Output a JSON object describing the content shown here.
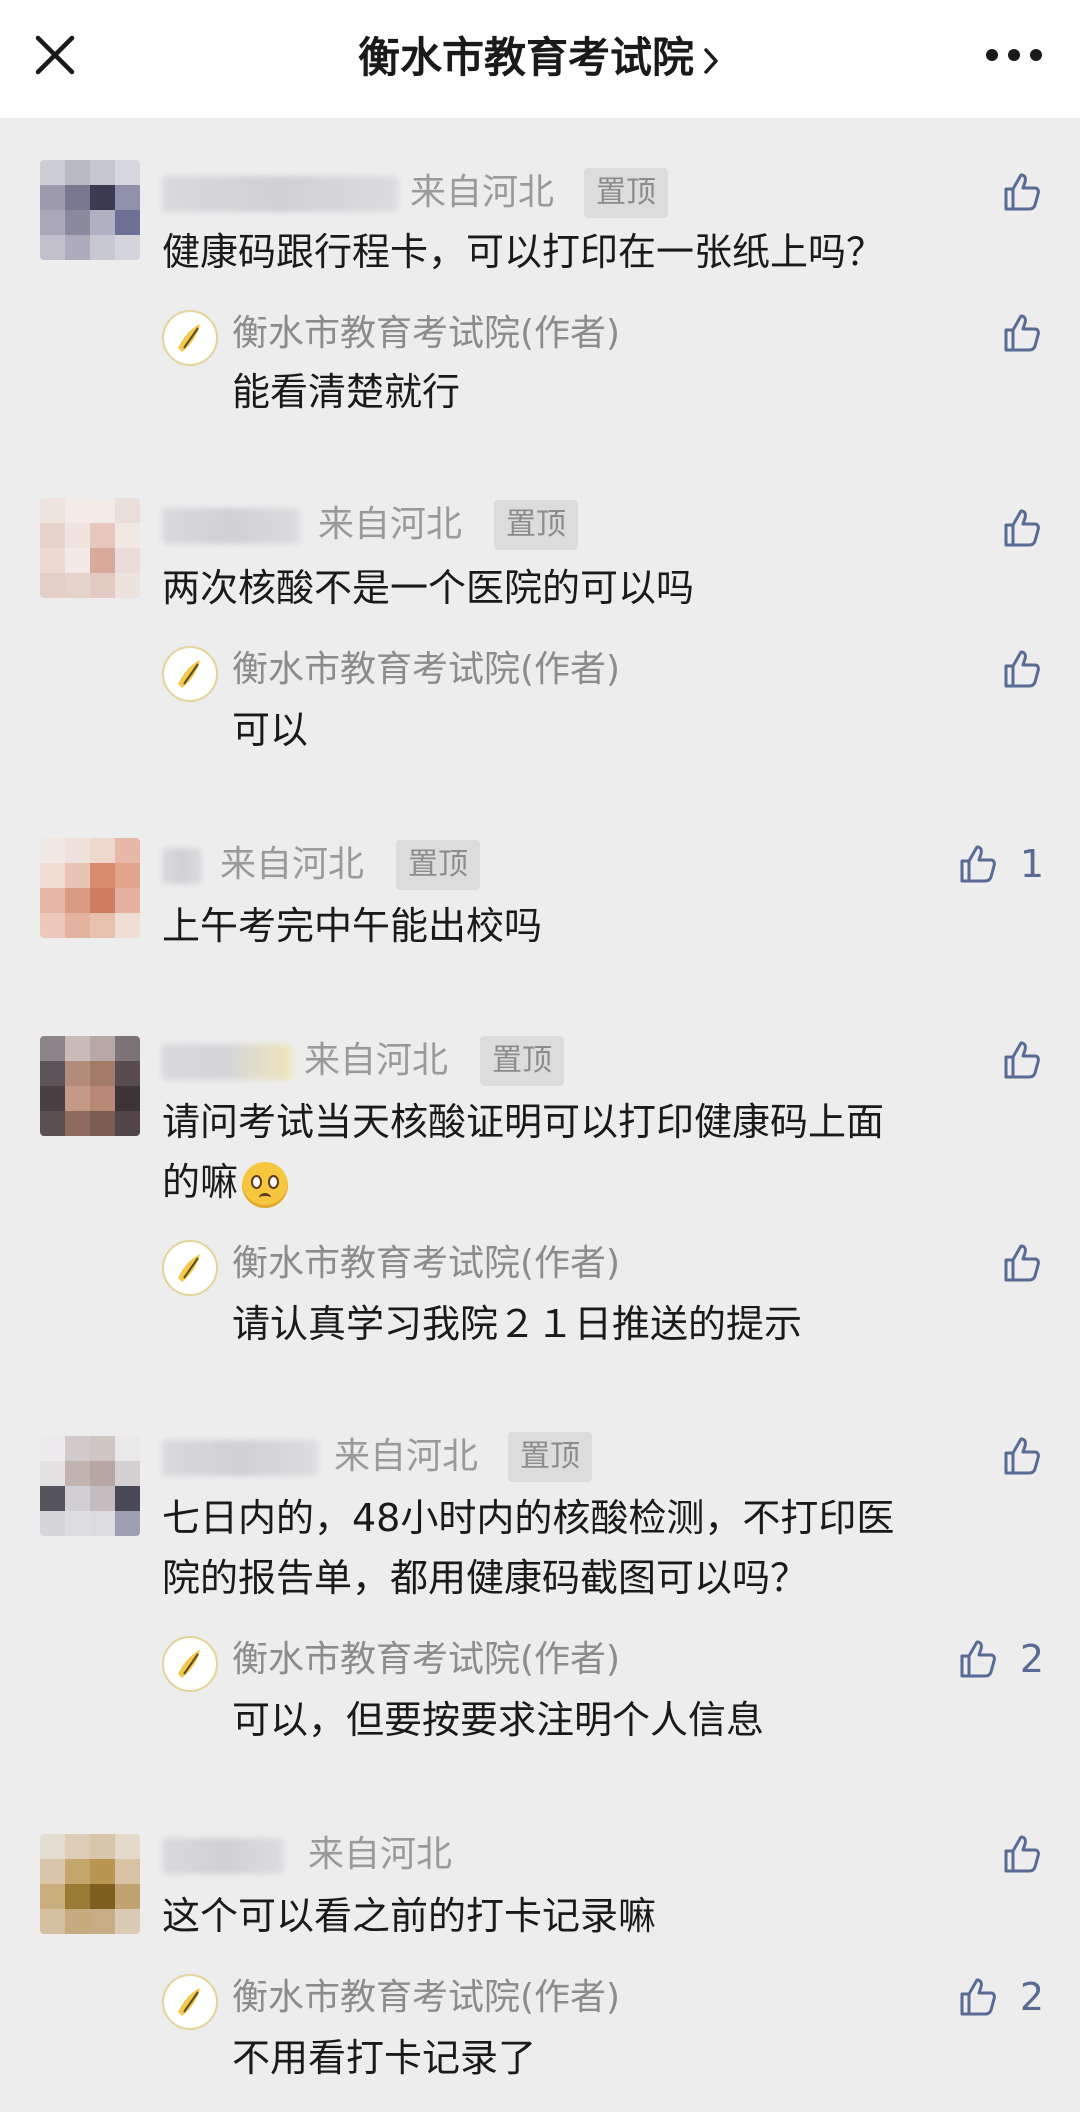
{
  "header": {
    "title": "衡水市教育考试院",
    "close_icon": "close-icon",
    "more_icon": "more-icon"
  },
  "comments": [
    {
      "location": "来自河北",
      "pin": "置顶",
      "text": "健康码跟行程卡，可以打印在一张纸上吗？",
      "likes": "",
      "reply": {
        "author": "衡水市教育考试院(作者)",
        "text": "能看清楚就行",
        "likes": ""
      }
    },
    {
      "location": "来自河北",
      "pin": "置顶",
      "text": "两次核酸不是一个医院的可以吗",
      "likes": "",
      "reply": {
        "author": "衡水市教育考试院(作者)",
        "text": "可以",
        "likes": ""
      }
    },
    {
      "location": "来自河北",
      "pin": "置顶",
      "text": "上午考完中午能出校吗",
      "likes": "1"
    },
    {
      "location": "来自河北",
      "pin": "置顶",
      "text_line1": "请问考试当天核酸证明可以打印健康码上面",
      "text_line2": "的嘛",
      "likes": "",
      "reply": {
        "author": "衡水市教育考试院(作者)",
        "text": "请认真学习我院２１日推送的提示",
        "likes": ""
      }
    },
    {
      "location": "来自河北",
      "pin": "置顶",
      "text_line1": "七日内的，48小时内的核酸检测，不打印医",
      "text_line2": "院的报告单，都用健康码截图可以吗？",
      "likes": "",
      "reply": {
        "author": "衡水市教育考试院(作者)",
        "text": "可以，但要按要求注明个人信息",
        "likes": "2"
      }
    },
    {
      "location": "来自河北",
      "text": "这个可以看之前的打卡记录嘛",
      "likes": "",
      "reply": {
        "author": "衡水市教育考试院(作者)",
        "text": "不用看打卡记录了",
        "likes": "2"
      }
    }
  ],
  "colors": {
    "link": "#576b95",
    "meta": "#9a9a9a",
    "background": "#ededed"
  }
}
